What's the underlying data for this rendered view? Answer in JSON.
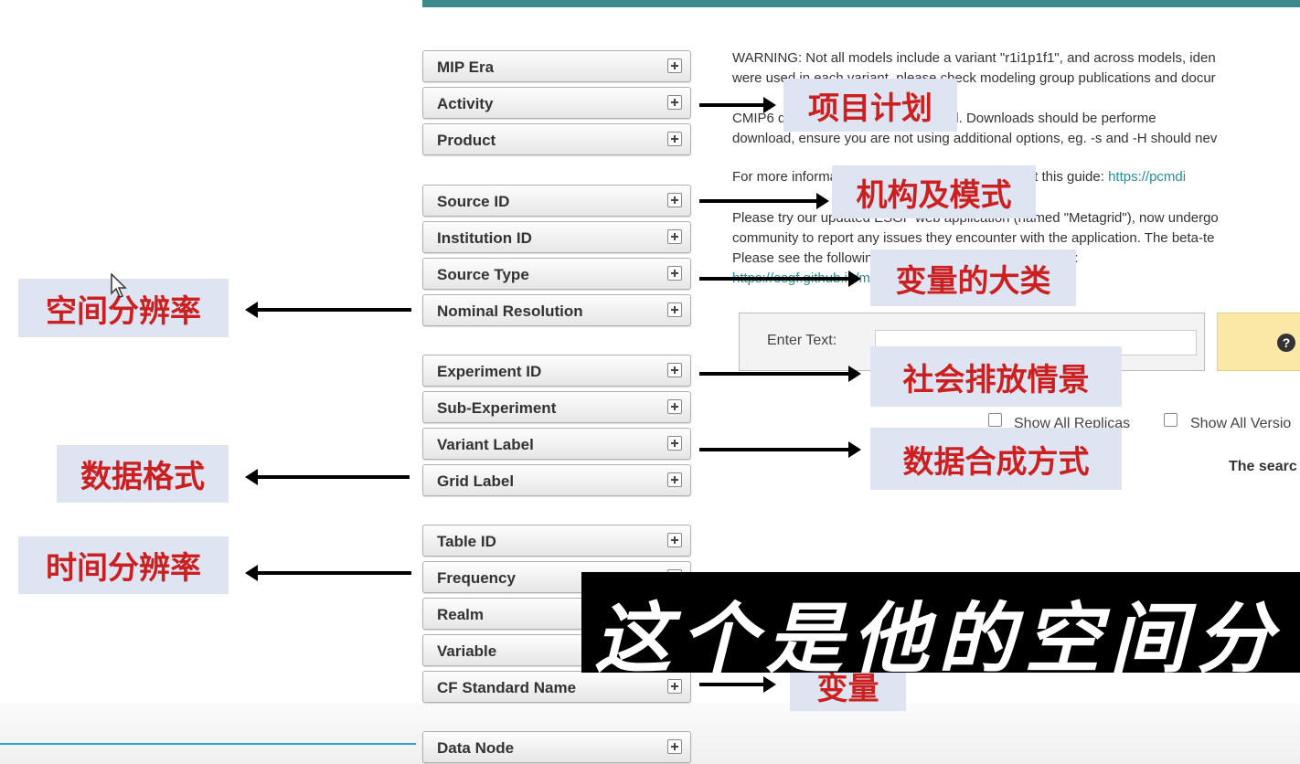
{
  "facets": [
    {
      "label": "MIP Era"
    },
    {
      "label": "Activity"
    },
    {
      "label": "Product"
    },
    {
      "label": "Source ID"
    },
    {
      "label": "Institution ID"
    },
    {
      "label": "Source Type"
    },
    {
      "label": "Nominal Resolution"
    },
    {
      "label": "Experiment ID"
    },
    {
      "label": "Sub-Experiment"
    },
    {
      "label": "Variant Label"
    },
    {
      "label": "Grid Label"
    },
    {
      "label": "Table ID"
    },
    {
      "label": "Frequency"
    },
    {
      "label": "Realm"
    },
    {
      "label": "Variable"
    },
    {
      "label": "CF Standard Name"
    },
    {
      "label": "Data Node"
    }
  ],
  "content": {
    "warning_line1": "WARNING: Not all models include a variant \"r1i1p1f1\", and across models, iden",
    "warning_line2": "were used in each variant, please check modeling group publications and docur",
    "cmip6_line1": "CMIP6 data holdings are unrestricted. Downloads should be performe",
    "cmip6_line2": "download, ensure you are not using additional options, eg. -s and -H should nev",
    "info_text": "For more information on the search please consult this guide: ",
    "info_link": "https://pcmdi",
    "metagrid_line1": "Please try our updated ESGF web application (named \"Metagrid\"), now undergo",
    "metagrid_line2": "community to report any issues they encounter with the application. The beta-te",
    "metagrid_line3": "Please see the following documentation including a FAQ:",
    "metagrid_link": "https://esgf.github.io/metagrid.html"
  },
  "search": {
    "label": "Enter Text:",
    "value": "",
    "help_icon": "?"
  },
  "options": {
    "show_all_replicas": "Show All Replicas",
    "show_all_versions": "Show All Versio"
  },
  "status_text": "The searc",
  "annotations": {
    "activity": "项目计划",
    "source_id": "机构及模式",
    "source_type": "变量的大类",
    "nominal_resolution": "空间分辨率",
    "experiment_id": "社会排放情景",
    "variant_label": "数据合成方式",
    "grid_label": "数据格式",
    "frequency": "时间分辨率",
    "cf_standard_name": "变量"
  },
  "subtitle": "这个是他的空间分",
  "colors": {
    "annotation_bg": "#dfe4f2",
    "annotation_text": "#cc1f1f",
    "top_bar": "#3c8a8a",
    "link": "#2a8b96",
    "help_button": "#fbe8a6"
  }
}
